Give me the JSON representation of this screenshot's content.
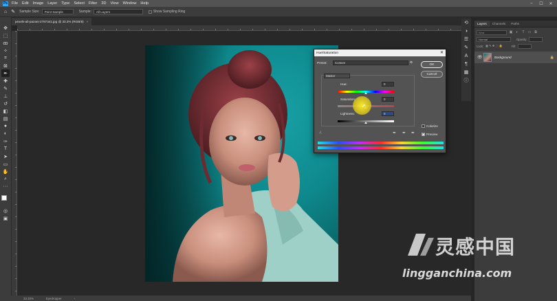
{
  "menu": [
    "File",
    "Edit",
    "Image",
    "Layer",
    "Type",
    "Select",
    "Filter",
    "3D",
    "View",
    "Window",
    "Help"
  ],
  "options_bar": {
    "sample_size_label": "Sample Size:",
    "sample_size_value": "Point Sample",
    "sample_label": "Sample:",
    "sample_value": "All Layers",
    "show_ring_label": "Show Sampling Ring"
  },
  "document_tab": {
    "title": "pexels-ali-pazani-2787341.jpg @ 33.3% (RGB/8)",
    "close_glyph": "×"
  },
  "status_bar": {
    "zoom": "33.33%",
    "tool": "Eyedropper"
  },
  "panels": {
    "tabs": [
      "Layers",
      "Channels",
      "Paths"
    ],
    "search_placeholder": "Kind",
    "blend_mode": "Normal",
    "opacity_label": "Opacity:",
    "lock_label": "Lock:",
    "fill_label": "Fill:",
    "layer_name": "Background"
  },
  "hue_saturation": {
    "title": "Hue/Saturation",
    "preset_label": "Preset:",
    "preset_value": "Custom",
    "channel_value": "Master",
    "hue_label": "Hue:",
    "hue_value": "0",
    "saturation_label": "Saturation:",
    "saturation_value": "0",
    "lightness_label": "Lightness:",
    "lightness_value": "0",
    "ok_label": "OK",
    "cancel_label": "Cancel",
    "colorize_label": "Colorize",
    "colorize_checked": false,
    "preview_label": "Preview",
    "preview_checked": true,
    "hue_position": 0.5,
    "saturation_position": 0.5,
    "lightness_position": 0.5
  },
  "watermark": {
    "title": "灵感中国",
    "url": "lingganchina.com"
  },
  "colors": {
    "accent": "#31a8ff",
    "photo_background": "#0e8a8e",
    "cursor_highlight": "#f0e028"
  }
}
